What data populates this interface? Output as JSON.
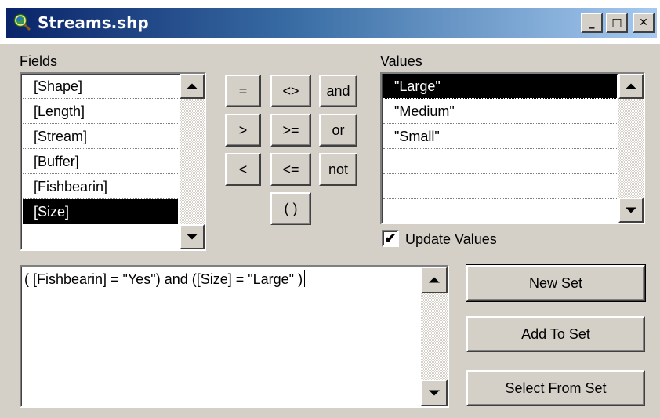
{
  "window": {
    "title": "Streams.shp",
    "minimize_glyph": "_",
    "maximize_glyph": "□",
    "close_glyph": "✕",
    "icon": "globe-magnifier-icon"
  },
  "fields": {
    "label": "Fields",
    "items": [
      "[Shape]",
      "[Length]",
      "[Stream]",
      "[Buffer]",
      "[Fishbearin]",
      "[Size]"
    ],
    "selected": "[Size]"
  },
  "operators": {
    "eq": "=",
    "ne": "<>",
    "and": "and",
    "gt": ">",
    "ge": ">=",
    "or": "or",
    "lt": "<",
    "le": "<=",
    "not": "not",
    "paren": "( )"
  },
  "values": {
    "label": "Values",
    "items": [
      "\"Large\"",
      "\"Medium\"",
      "\"Small\""
    ],
    "selected": "\"Large\""
  },
  "update_values": {
    "label": "Update Values",
    "checked": true,
    "check_glyph": "✔"
  },
  "expression": {
    "text": "( [Fishbearin] = \"Yes\") and ([Size] = \"Large\" )"
  },
  "actions": {
    "new_set": "New Set",
    "add_to_set": "Add To Set",
    "select_from_set": "Select From Set"
  }
}
